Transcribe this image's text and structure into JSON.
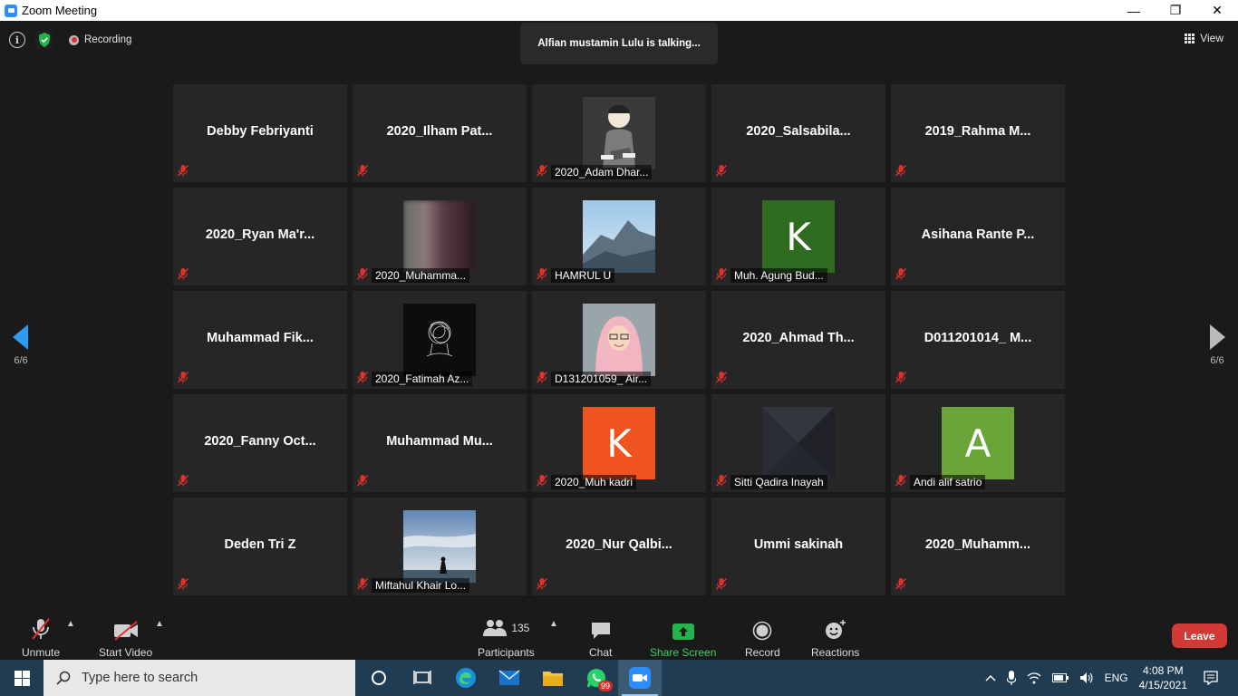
{
  "window": {
    "title": "Zoom Meeting",
    "minimize": "—",
    "maximize": "❐",
    "close": "✕"
  },
  "topbar": {
    "recording_label": "Recording",
    "talking": "Alfian mustamin Lulu is talking...",
    "view_label": "View"
  },
  "pagination": {
    "left": "6/6",
    "right": "6/6"
  },
  "tiles": [
    {
      "name": "Debby Febriyanti",
      "label": "",
      "photo": "none"
    },
    {
      "name": "2020_Ilham  Pat...",
      "label": "",
      "photo": "none"
    },
    {
      "name": "",
      "label": "2020_Adam Dhar...",
      "photo": "cartoon-avatar"
    },
    {
      "name": "2020_Salsabila...",
      "label": "",
      "photo": "none"
    },
    {
      "name": "2019_Rahma  M...",
      "label": "",
      "photo": "none"
    },
    {
      "name": "2020_Ryan  Ma'r...",
      "label": "",
      "photo": "none"
    },
    {
      "name": "",
      "label": "2020_Muhamma...",
      "photo": "blurred-photo"
    },
    {
      "name": "",
      "label": "HAMRUL U",
      "photo": "mountain-photo"
    },
    {
      "name": "",
      "label": "Muh. Agung Bud...",
      "photo": "letter",
      "letter": "K",
      "color": "#2e6b1e"
    },
    {
      "name": "Asihana Rante P...",
      "label": "",
      "photo": "none"
    },
    {
      "name": "Muhammad  Fik...",
      "label": "",
      "photo": "none"
    },
    {
      "name": "",
      "label": "2020_Fatimah Az...",
      "photo": "sketch-photo"
    },
    {
      "name": "",
      "label": "D131201059_ Air...",
      "photo": "hijab-photo"
    },
    {
      "name": "2020_Ahmad  Th...",
      "label": "",
      "photo": "none"
    },
    {
      "name": "D011201014_  M...",
      "label": "",
      "photo": "none"
    },
    {
      "name": "2020_Fanny  Oct...",
      "label": "",
      "photo": "none"
    },
    {
      "name": "Muhammad  Mu...",
      "label": "",
      "photo": "none"
    },
    {
      "name": "",
      "label": "2020_Muh kadri",
      "photo": "letter",
      "letter": "K",
      "color": "#f0541e"
    },
    {
      "name": "",
      "label": "Sitti Qadira Inayah",
      "photo": "dark-geometric"
    },
    {
      "name": "",
      "label": "Andi alif satrio",
      "photo": "letter",
      "letter": "A",
      "color": "#6aa53a"
    },
    {
      "name": "Deden Tri Z",
      "label": "",
      "photo": "none"
    },
    {
      "name": "",
      "label": "Miftahul Khair Lo...",
      "photo": "beach-photo"
    },
    {
      "name": "2020_Nur  Qalbi...",
      "label": "",
      "photo": "none"
    },
    {
      "name": "Ummi sakinah",
      "label": "",
      "photo": "none"
    },
    {
      "name": "2020_Muhamm...",
      "label": "",
      "photo": "none"
    }
  ],
  "toolbar": {
    "unmute": "Unmute",
    "start_video": "Start Video",
    "participants": "Participants",
    "participant_count": "135",
    "chat": "Chat",
    "share_screen": "Share Screen",
    "record": "Record",
    "reactions": "Reactions",
    "leave": "Leave"
  },
  "taskbar": {
    "search_placeholder": "Type here to search",
    "whatsapp_badge": "99",
    "language": "ENG",
    "time": "4:08 PM",
    "date": "4/15/2021"
  }
}
